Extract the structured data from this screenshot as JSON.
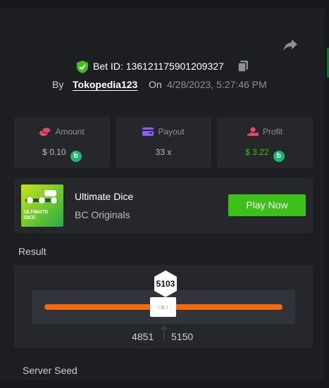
{
  "bet": {
    "id_label": "Bet ID:",
    "id_value": "136121175901209327",
    "by_label": "By",
    "user": "Tokopedia123",
    "on_label": "On",
    "date": "4/28/2023, 5:27:46 PM"
  },
  "stats": [
    {
      "label": "Amount",
      "value": "$ 0.10",
      "icon": "coins-icon",
      "icon_color": "#e8456b",
      "value_color": "#b9bcc1",
      "coin": "bcd-coin-icon"
    },
    {
      "label": "Payout",
      "value": "33 x",
      "icon": "wallet-icon",
      "icon_color": "#8b5cf6",
      "value_color": "#b9bcc1"
    },
    {
      "label": "Profit",
      "value": "$ 3.22",
      "icon": "hand-coin-icon",
      "icon_color": "#e8456b",
      "value_color": "#3bc117",
      "coin": "bcd-coin-icon"
    }
  ],
  "game": {
    "name": "Ultimate Dice",
    "provider": "BC Originals",
    "thumb_text": "ULTIMATE DICE",
    "play_label": "Play Now",
    "play_color": "#3bc117"
  },
  "result": {
    "label": "Result",
    "value": "5103",
    "range_low": "4851",
    "range_high": "5150",
    "bar_color": "#f5680b"
  },
  "server_seed_label": "Server Seed",
  "colors": {
    "accent_green": "#3bc117",
    "background": "#1c1e22",
    "card": "#25272b"
  }
}
